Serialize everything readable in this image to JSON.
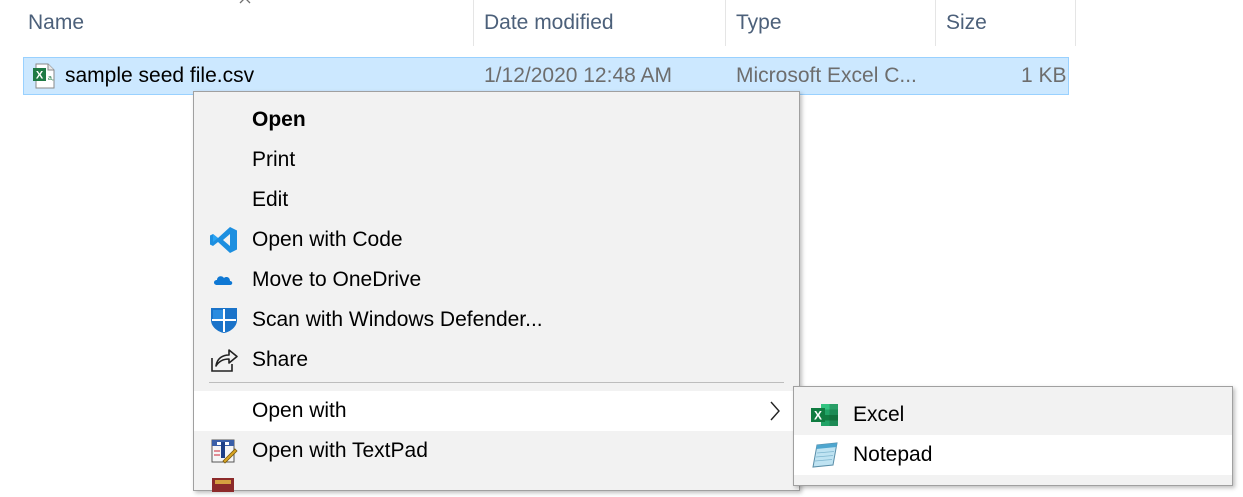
{
  "columns": {
    "name": "Name",
    "date_modified": "Date modified",
    "type": "Type",
    "size": "Size"
  },
  "file": {
    "name": "sample seed file.csv",
    "date_modified": "1/12/2020 12:48 AM",
    "type": "Microsoft Excel C...",
    "size": "1 KB",
    "icon": "excel-csv-file-icon"
  },
  "context_menu": {
    "items": [
      {
        "label": "Open",
        "icon": ""
      },
      {
        "label": "Print",
        "icon": ""
      },
      {
        "label": "Edit",
        "icon": ""
      },
      {
        "label": "Open with Code",
        "icon": "vscode-icon"
      },
      {
        "label": "Move to OneDrive",
        "icon": "onedrive-icon"
      },
      {
        "label": "Scan with Windows Defender...",
        "icon": "windows-defender-icon"
      },
      {
        "label": "Share",
        "icon": "share-icon"
      },
      {
        "label": "Open with",
        "icon": ""
      },
      {
        "label": "Open with TextPad",
        "icon": "textpad-icon"
      }
    ]
  },
  "submenu": {
    "items": [
      {
        "label": "Excel",
        "icon": "excel-icon"
      },
      {
        "label": "Notepad",
        "icon": "notepad-icon"
      }
    ]
  },
  "colors": {
    "selection": "#cce8ff",
    "selection_border": "#99d1ff",
    "menu_bg": "#f2f2f2",
    "hover_bg": "#ffffff",
    "header_text": "#4c607a"
  }
}
